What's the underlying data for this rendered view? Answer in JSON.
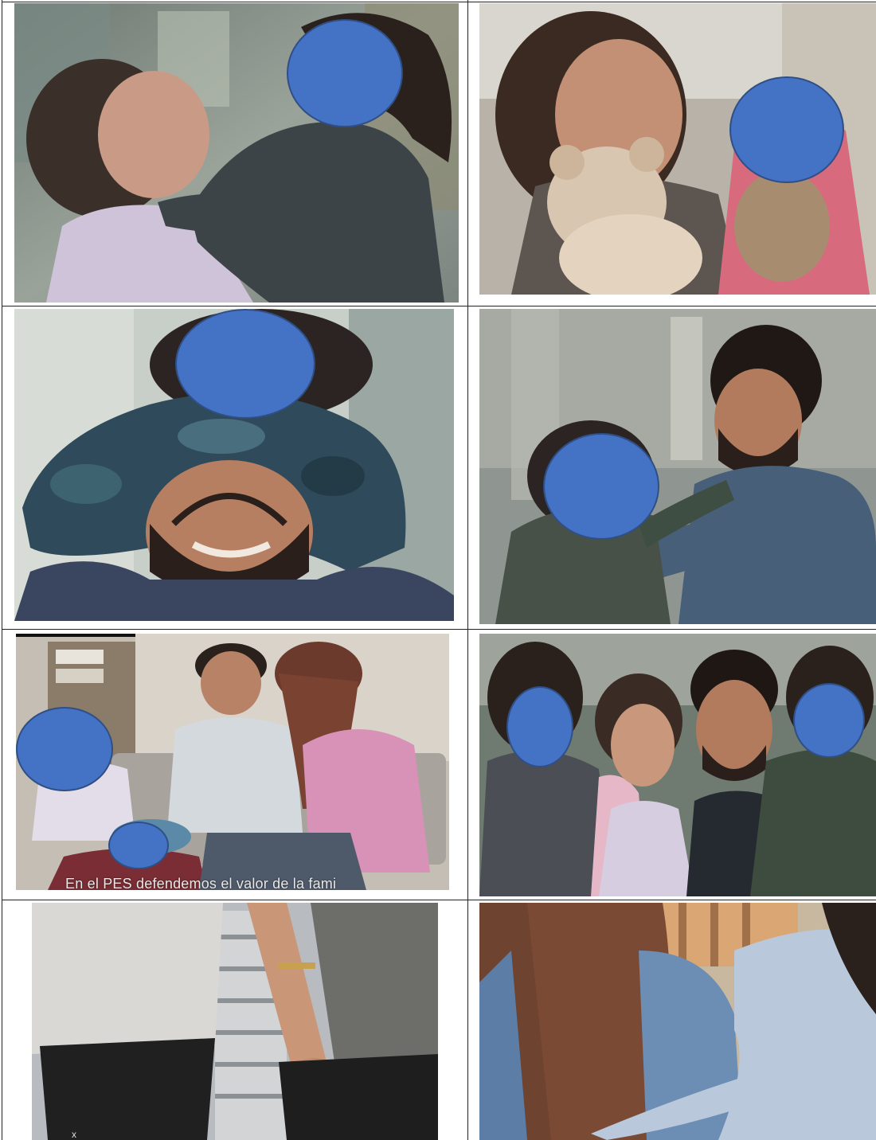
{
  "document": {
    "layout": "photo grid table",
    "rows": 4,
    "columns": 2
  },
  "colors": {
    "privacy_mask": "#4472c4",
    "privacy_mask_border": "#2f4f86",
    "grid_border": "#222222"
  },
  "icons": [
    "privacy-mask-ellipse"
  ],
  "caption": {
    "text": "En el PES defendemos el valor de la fami"
  },
  "mark": {
    "text": "x"
  }
}
